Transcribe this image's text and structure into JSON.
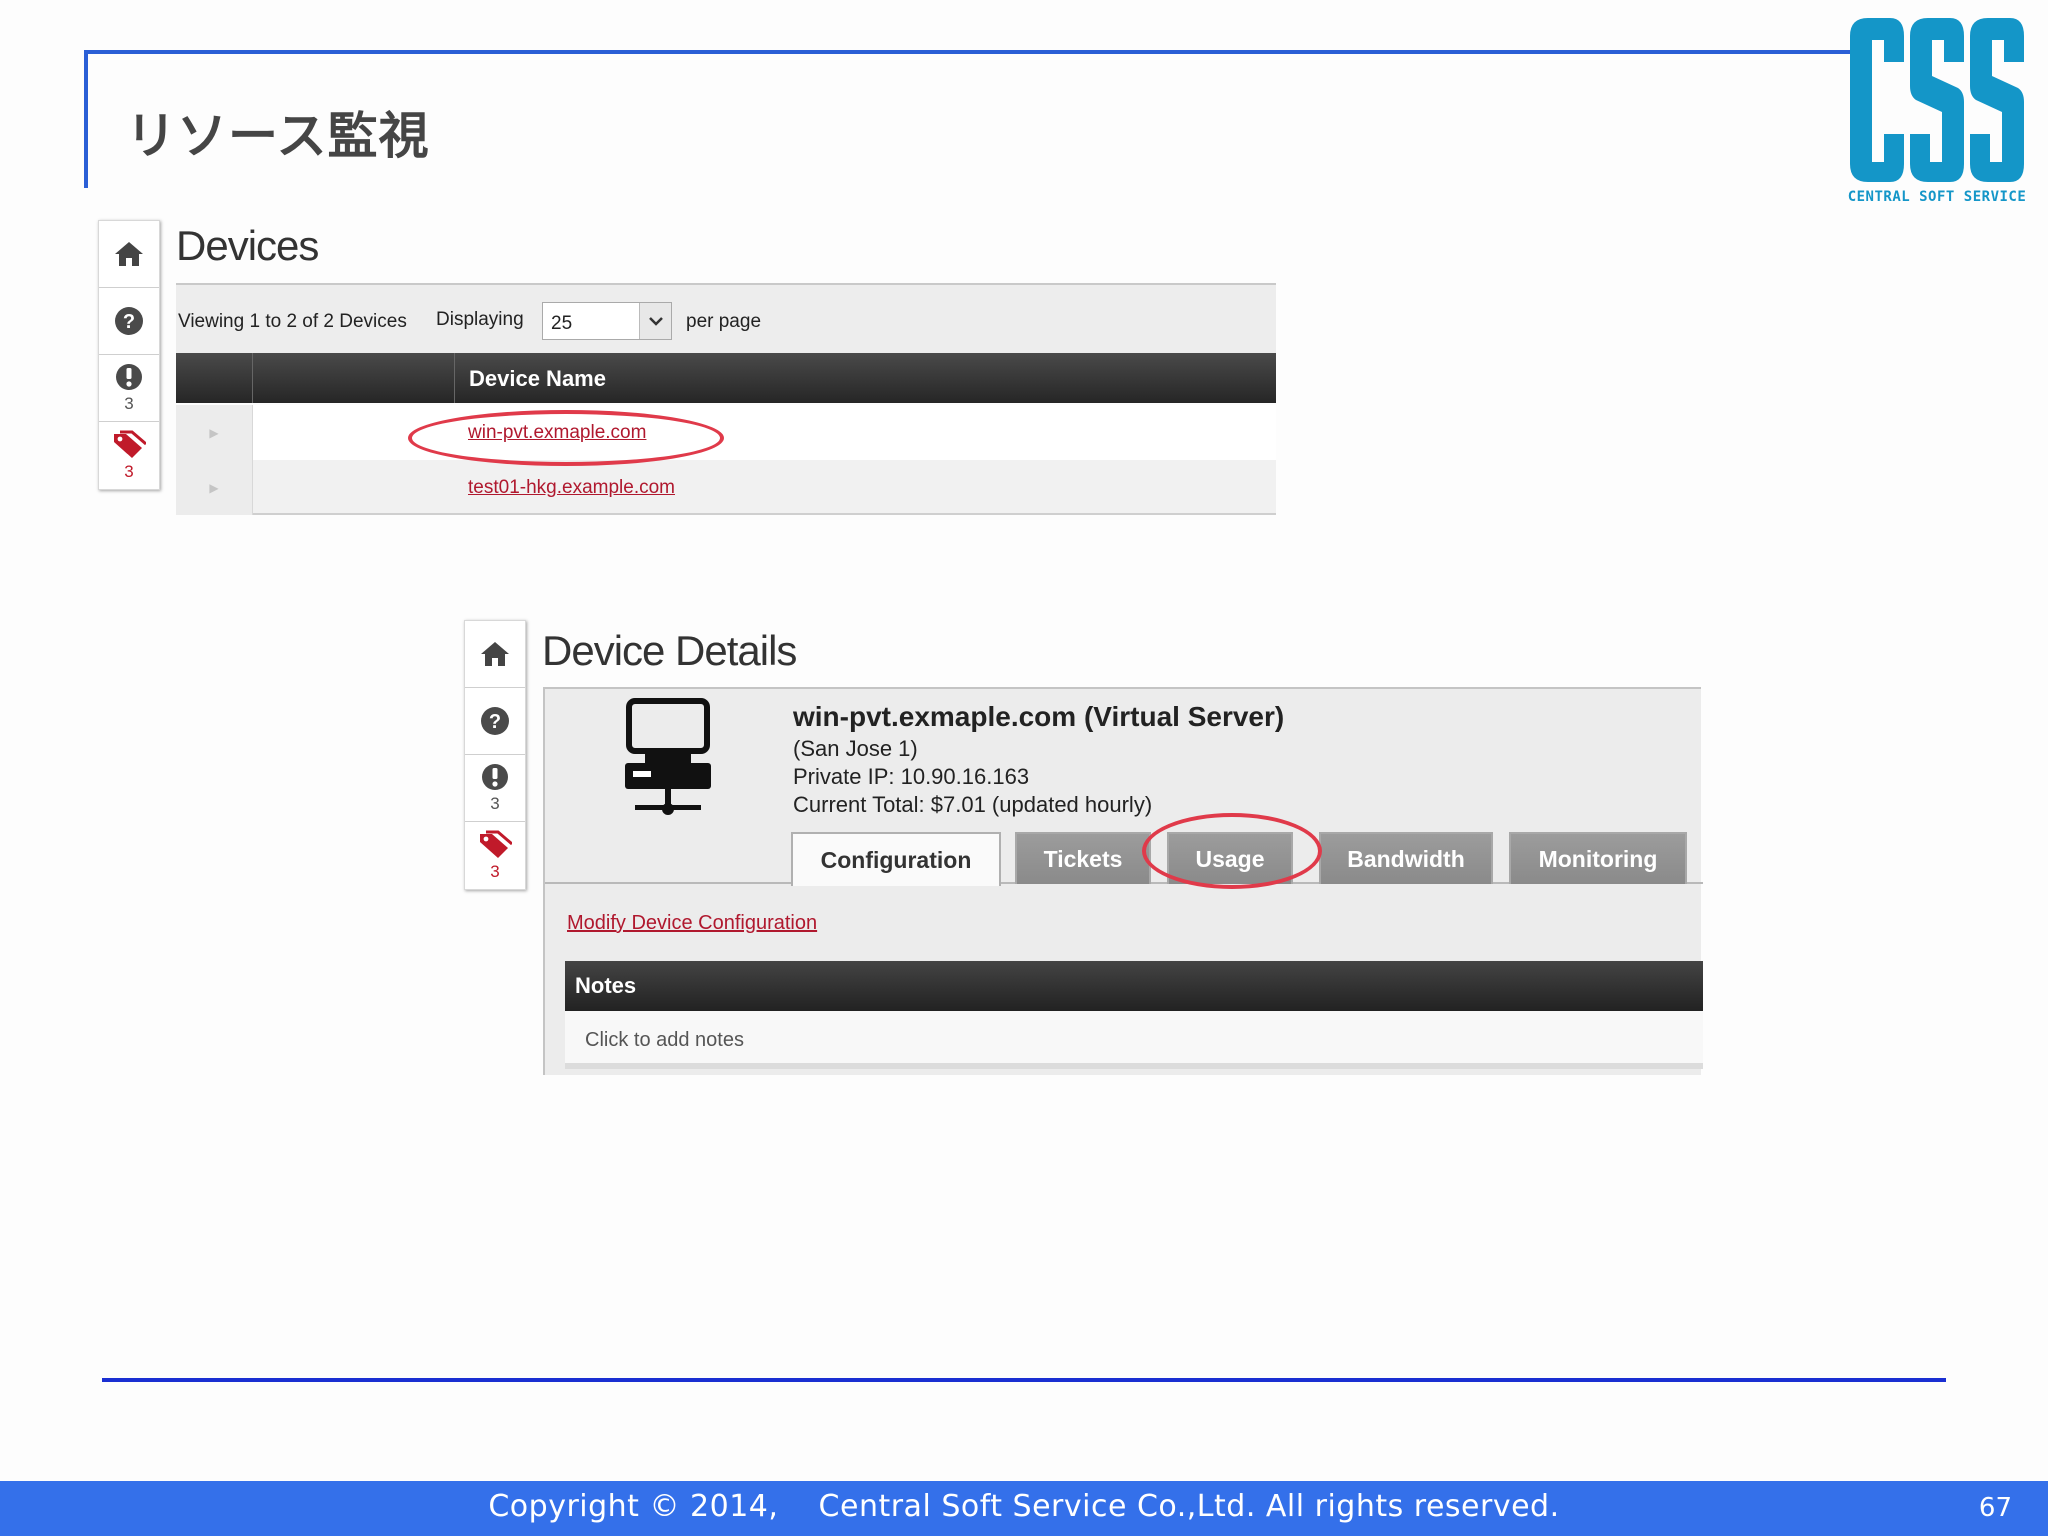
{
  "slide": {
    "title": "リソース監視",
    "footer": "Copyright © 2014,    Central Soft Service Co.,Ltd. All rights reserved.",
    "page_number": "67"
  },
  "logo": {
    "letters": "CSS",
    "tagline": "CENTRAL SOFT SERVICE",
    "color": "#1496c8"
  },
  "rail": {
    "icons": [
      "home-icon",
      "help-icon",
      "alert-icon",
      "tags-icon"
    ],
    "alert_count": "3",
    "tag_count": "3"
  },
  "devices_panel": {
    "title": "Devices",
    "viewing_text": "Viewing 1 to 2 of 2 Devices",
    "displaying_label": "Displaying",
    "per_page_value": "25",
    "per_page_label": "per page",
    "column_header": "Device Name",
    "rows": [
      {
        "name": "win-pvt.exmaple.com",
        "highlighted": true
      },
      {
        "name": "test01-hkg.example.com",
        "highlighted": false
      }
    ]
  },
  "details_panel": {
    "title": "Device Details",
    "device_name": "win-pvt.exmaple.com (Virtual Server)",
    "location": "(San Jose 1)",
    "private_ip": "Private IP: 10.90.16.163",
    "current_total": "Current Total: $7.01 (updated hourly)",
    "tabs": [
      {
        "label": "Configuration",
        "active": true
      },
      {
        "label": "Tickets",
        "active": false
      },
      {
        "label": "Usage",
        "active": false,
        "highlighted": true
      },
      {
        "label": "Bandwidth",
        "active": false
      },
      {
        "label": "Monitoring",
        "active": false
      }
    ],
    "modify_link": "Modify Device Configuration",
    "notes_header": "Notes",
    "notes_placeholder": "Click to add notes"
  },
  "colors": {
    "accent_blue": "#2b5fd6",
    "footer_blue": "#3470ea",
    "link_red": "#b0182e",
    "highlight_ring": "#e03a4a"
  }
}
